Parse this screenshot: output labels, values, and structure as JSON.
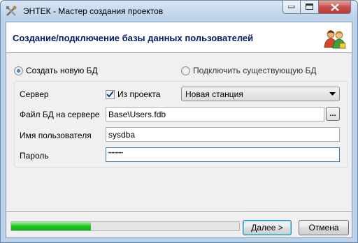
{
  "window": {
    "title": "ЭНТЕК - Мастер создания проектов",
    "icon": "tools-icon"
  },
  "header": {
    "title": "Создание/подключение базы данных пользователей",
    "icon": "users-icon"
  },
  "mode": {
    "create_label": "Создать новую БД",
    "connect_label": "Подключить существующую БД",
    "selected": "create"
  },
  "form": {
    "server_label": "Сервер",
    "from_project_label": "Из проекта",
    "from_project_checked": true,
    "server_value": "Новая станция",
    "db_file_label": "Файл БД на сервере",
    "db_file_value": "Base\\Users.fdb",
    "browse_label": "...",
    "username_label": "Имя пользователя",
    "username_value": "sysdba",
    "password_label": "Пароль",
    "password_value": "••••••••••"
  },
  "footer": {
    "progress": 0.35,
    "next_label": "Далее >",
    "cancel_label": "Отмена"
  },
  "colors": {
    "header_title": "#001a66",
    "progress_fill": "#1fc91f",
    "titlebar": "#c2d6ec"
  }
}
